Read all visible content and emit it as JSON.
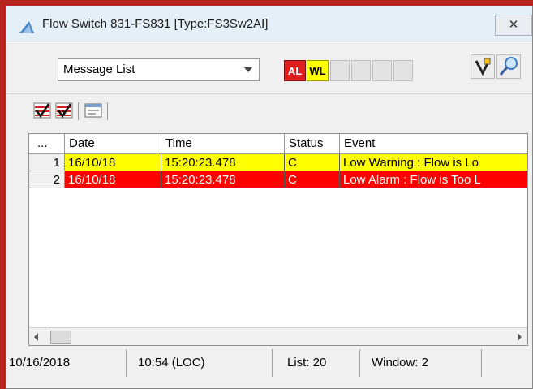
{
  "window": {
    "title": "Flow Switch 831-FS831  [Type:FS3Sw2AI]",
    "close_glyph": "✕"
  },
  "toolbar": {
    "view_select": "Message List",
    "al_label": "AL",
    "wl_label": "WL"
  },
  "icons": {
    "title": "flow-icon",
    "acknowledge": "acknowledge-check-icon",
    "acknowledge_all": "acknowledge-all-icon",
    "detail": "detail-window-icon",
    "tune": "tuning-icon",
    "search": "magnifier-icon"
  },
  "table": {
    "columns": [
      "...",
      "Date",
      "Time",
      "Status",
      "Event"
    ],
    "rows": [
      {
        "num": "1",
        "date": "16/10/18",
        "time": "15:20:23.478",
        "status": "C",
        "event": "Low Warning : Flow is  Lo",
        "color": "#ffff00",
        "text_color": "#000000"
      },
      {
        "num": "2",
        "date": "16/10/18",
        "time": "15:20:23.478",
        "status": "C",
        "event": "Low Alarm : Flow is Too L",
        "color": "#ff0000",
        "text_color": "#ffffff"
      }
    ]
  },
  "statusbar": {
    "date": "10/16/2018",
    "time": "10:54 (LOC)",
    "list": "List: 20",
    "window": "Window: 2"
  },
  "colors": {
    "frame": "#b8231f",
    "warning": "#ffff00",
    "alarm": "#ff0000",
    "al_badge": "#e01e1e",
    "wl_badge": "#ffff00"
  }
}
